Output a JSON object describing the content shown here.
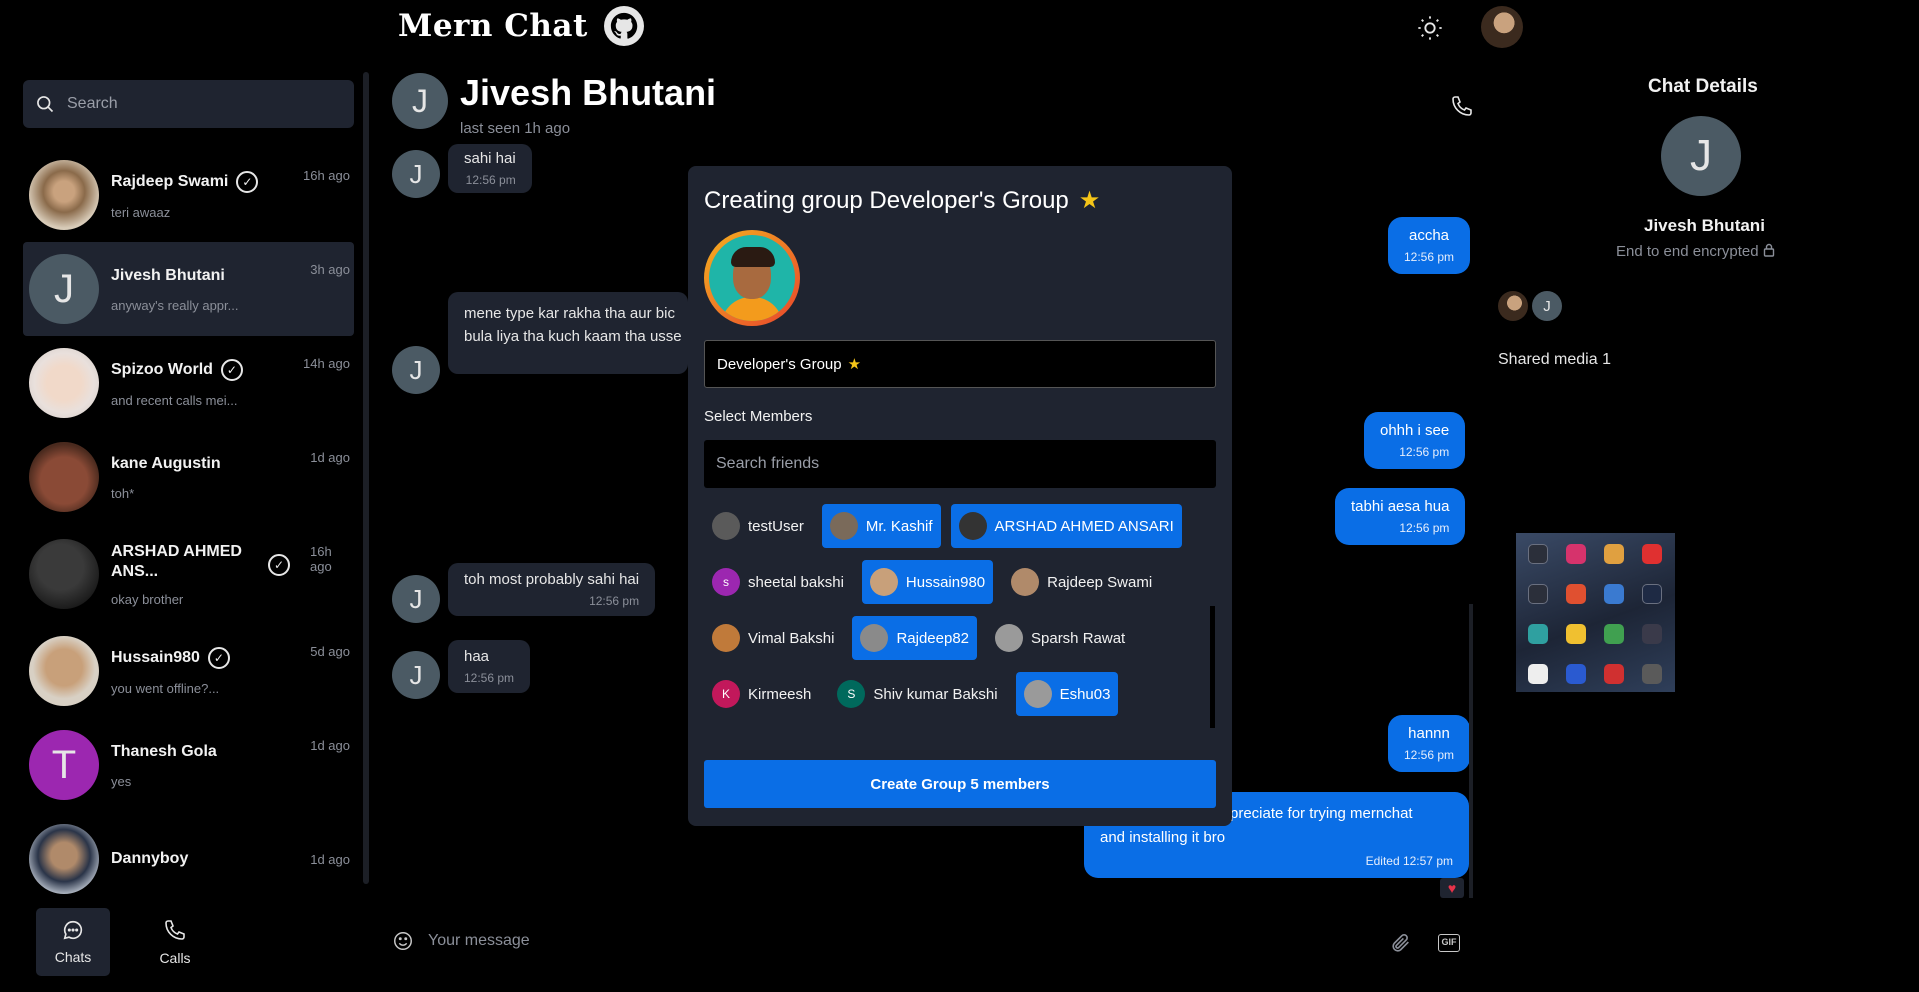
{
  "app": {
    "title": "Mern Chat"
  },
  "sidebar": {
    "search_placeholder": "Search",
    "chats": [
      {
        "name": "Rajdeep Swami",
        "preview": "teri awaaz",
        "time": "16h ago",
        "verified": true,
        "avatar": "photo"
      },
      {
        "name": "Jivesh Bhutani",
        "preview": "anyway's really appr...",
        "time": "3h ago",
        "verified": false,
        "avatar": "J"
      },
      {
        "name": "Spizoo World",
        "preview": "and recent calls mei...",
        "time": "14h ago",
        "verified": true,
        "avatar": "photo"
      },
      {
        "name": "kane Augustin",
        "preview": "toh*",
        "time": "1d ago",
        "verified": false,
        "avatar": "photo"
      },
      {
        "name": "ARSHAD AHMED ANS...",
        "preview": "okay brother",
        "time": "16h ago",
        "verified": true,
        "avatar": "photo"
      },
      {
        "name": "Hussain980",
        "preview": "you went offline?...",
        "time": "5d ago",
        "verified": true,
        "avatar": "photo"
      },
      {
        "name": "Thanesh Gola",
        "preview": "yes",
        "time": "1d ago",
        "verified": false,
        "avatar": "T"
      },
      {
        "name": "Dannyboy",
        "preview": "",
        "time": "1d ago",
        "verified": false,
        "avatar": "photo"
      }
    ],
    "nav": {
      "chats": "Chats",
      "calls": "Calls"
    }
  },
  "chat": {
    "header": {
      "avatar": "J",
      "name": "Jivesh Bhutani",
      "status": "last seen 1h ago"
    },
    "messages": [
      {
        "text": "sahi hai",
        "time": "12:56 pm"
      },
      {
        "text": "accha",
        "time": "12:56 pm"
      },
      {
        "line1": "mene type kar rakha tha aur bic",
        "line2": "bula liya tha kuch kaam tha usse"
      },
      {
        "text": "ohhh i see",
        "time": "12:56 pm"
      },
      {
        "text": "tabhi aesa hua",
        "time": "12:56 pm"
      },
      {
        "text": "toh most probably sahi hai",
        "time": "12:56 pm"
      },
      {
        "text": "haa",
        "time": "12:56 pm"
      },
      {
        "text": "hannn",
        "time": "12:56 pm"
      },
      {
        "line1": "preciate for trying mernchat",
        "line2": "and installing it bro",
        "time": "Edited 12:57 pm"
      }
    ],
    "compose_placeholder": "Your message"
  },
  "details": {
    "title": "Chat Details",
    "avatar": "J",
    "name": "Jivesh Bhutani",
    "encryption": "End to end encrypted",
    "member_initial": "J",
    "shared_media": "Shared media 1"
  },
  "modal": {
    "title": "Creating group Developer's Group",
    "title_emoji": "⭐",
    "group_name": "Developer's Group",
    "group_emoji": "⭐",
    "select_label": "Select Members",
    "search_placeholder": "Search friends",
    "friends": [
      {
        "name": "testUser",
        "selected": false,
        "initial": "",
        "color": "#5a5a5a"
      },
      {
        "name": "Mr. Kashif",
        "selected": true,
        "initial": "",
        "color": "#7a6a5a"
      },
      {
        "name": "ARSHAD AHMED ANSARI",
        "selected": true,
        "initial": "",
        "color": "#333333"
      },
      {
        "name": "sheetal bakshi",
        "selected": false,
        "initial": "s",
        "color": "#9c27b0"
      },
      {
        "name": "Hussain980",
        "selected": true,
        "initial": "",
        "color": "#c8a07a"
      },
      {
        "name": "Rajdeep Swami",
        "selected": false,
        "initial": "",
        "color": "#b08a6a"
      },
      {
        "name": "Vimal Bakshi",
        "selected": false,
        "initial": "",
        "color": "#c07a3a"
      },
      {
        "name": "Rajdeep82",
        "selected": true,
        "initial": "",
        "color": "#8a8a8a"
      },
      {
        "name": "Sparsh Rawat",
        "selected": false,
        "initial": "",
        "color": "#9a9a9a"
      },
      {
        "name": "Kirmeesh",
        "selected": false,
        "initial": "K",
        "color": "#c2185b"
      },
      {
        "name": "Shiv kumar Bakshi",
        "selected": false,
        "initial": "S",
        "color": "#00695c"
      },
      {
        "name": "Eshu03",
        "selected": true,
        "initial": "",
        "color": "#9a9a9a"
      }
    ],
    "create_button": "Create Group 5 members"
  },
  "colors": {
    "accent": "#0a6ee6",
    "panel": "#1f2430",
    "background": "#000000"
  }
}
